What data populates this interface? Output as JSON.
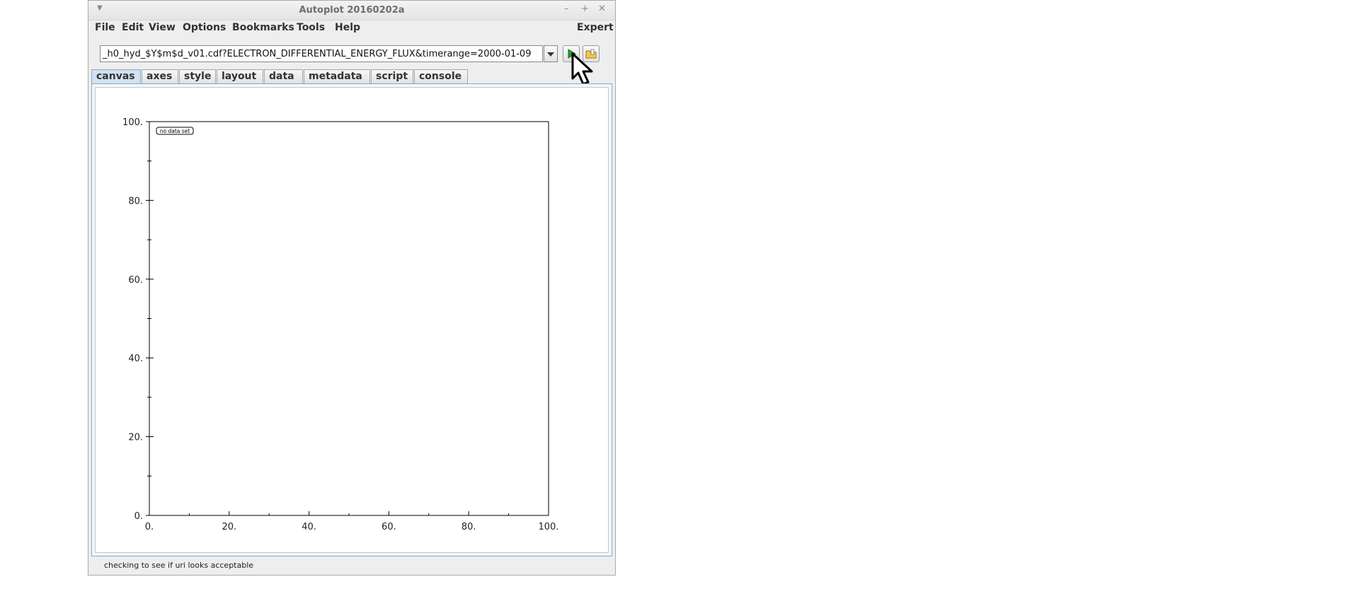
{
  "window": {
    "title": "Autoplot 20160202a"
  },
  "menubar": {
    "items": [
      "File",
      "Edit",
      "View",
      "Options",
      "Bookmarks",
      "Tools",
      "Help"
    ],
    "expert": "Expert"
  },
  "uri": {
    "value": "_h0_hyd_$Y$m$d_v01.cdf?ELECTRON_DIFFERENTIAL_ENERGY_FLUX&timerange=2000-01-09"
  },
  "tabs": [
    "canvas",
    "axes",
    "style",
    "layout",
    "data",
    "metadata",
    "script",
    "console"
  ],
  "active_tab": "canvas",
  "plot": {
    "legend": "no data set",
    "x_ticks": [
      "0.",
      "20.",
      "40.",
      "60.",
      "80.",
      "100."
    ],
    "y_ticks": [
      "0.",
      "20.",
      "40.",
      "60.",
      "80.",
      "100."
    ],
    "xlim": [
      0,
      100
    ],
    "ylim": [
      0,
      100
    ]
  },
  "status": "checking to see if uri looks acceptable",
  "colors": {
    "accent": "#8aa6c6",
    "tab_active": "#d3e1f1",
    "play_green": "#2e9a2e"
  }
}
